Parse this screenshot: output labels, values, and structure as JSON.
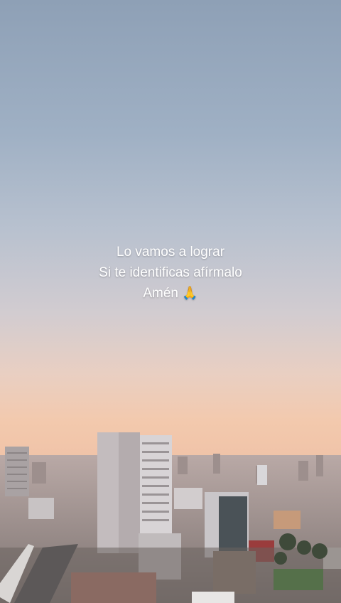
{
  "overlay": {
    "line1": "Lo vamos a lograr",
    "line2": "Si te identificas afírmalo",
    "line3": "Amén",
    "emoji": "🙏"
  },
  "colors": {
    "sky_top": "#8ea0b6",
    "sky_horizon": "#f3c9ad",
    "text": "#ffffff"
  }
}
